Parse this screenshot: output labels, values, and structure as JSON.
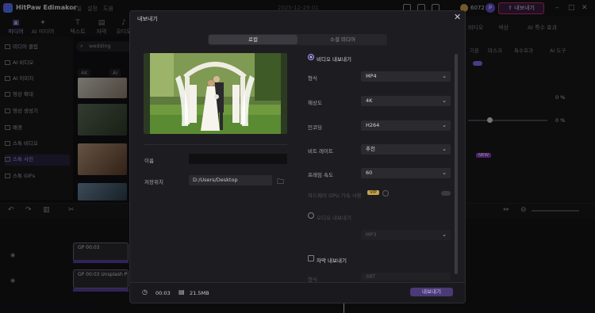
{
  "app": {
    "name": "HitPaw Edimakor",
    "menu": [
      "파일",
      "설정",
      "도움"
    ],
    "date": "2025-12-29 01",
    "credits": "6072",
    "avatar_letter": "P",
    "export_label": "내보내기"
  },
  "left": {
    "tabs": [
      "미디어",
      "AI 미디어",
      "텍스트",
      "자막",
      "오디오"
    ],
    "search": "wedding",
    "chips": [
      "4K",
      "AI"
    ],
    "sidebar": [
      "미디어 클립",
      "AI 비디오",
      "AI 이미지",
      "영상 확대",
      "영상 생성기",
      "배경",
      "스톡 비디오",
      "스톡 사진",
      "스톡 GIFs"
    ]
  },
  "right": {
    "tabs": [
      "비디오",
      "색상",
      "AI 특수 효과"
    ],
    "subtabs": [
      "기본",
      "마스크",
      "특수효과",
      "AI 도구"
    ],
    "values": [
      "0 %",
      "0 %"
    ],
    "badge": "NEW"
  },
  "timeline": {
    "clips": [
      "GP 00:03",
      "GP 00:03 Unsplash P"
    ]
  },
  "dialog": {
    "title": "내보내기",
    "close": "✕",
    "tabs": {
      "local": "로컬",
      "social": "소셜 미디어"
    },
    "name_label": "이름",
    "path_label": "저장위치",
    "path_value": "D:/Users/Desktop",
    "video_export": "비디오 내보내기",
    "settings": [
      {
        "label": "형식",
        "value": "MP4"
      },
      {
        "label": "해상도",
        "value": "4K"
      },
      {
        "label": "인코딩",
        "value": "H264"
      },
      {
        "label": "비트 레이트",
        "value": "추천"
      },
      {
        "label": "프레임 속도",
        "value": "60"
      }
    ],
    "gpu_label": "하드웨어 GPU 가속 사용",
    "vip": "VIP",
    "audio_export": "오디오 내보내기",
    "audio_format_value": "MP3",
    "subtitle_export": "자막 내보내기",
    "subtitle_format_label": "형식",
    "subtitle_format_value": "SRT",
    "footer": {
      "duration": "00:03",
      "size": "21.5MB",
      "export": "내보내기"
    }
  }
}
